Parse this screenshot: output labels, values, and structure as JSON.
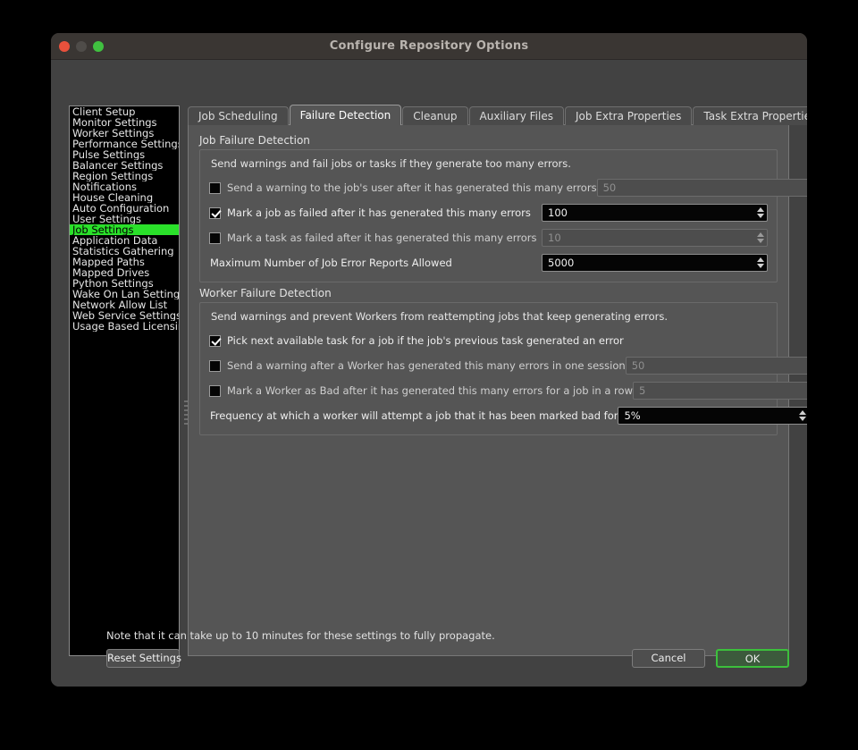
{
  "window": {
    "title": "Configure Repository Options",
    "traffic_lights": [
      "close-red",
      "minimize-gray",
      "zoom-green"
    ]
  },
  "sidebar": {
    "items": [
      {
        "label": "Client Setup",
        "selected": false
      },
      {
        "label": "Monitor Settings",
        "selected": false
      },
      {
        "label": "Worker Settings",
        "selected": false
      },
      {
        "label": "Performance Settings",
        "selected": false
      },
      {
        "label": "Pulse Settings",
        "selected": false
      },
      {
        "label": "Balancer Settings",
        "selected": false
      },
      {
        "label": "Region Settings",
        "selected": false
      },
      {
        "label": "Notifications",
        "selected": false
      },
      {
        "label": "House Cleaning",
        "selected": false
      },
      {
        "label": "Auto Configuration",
        "selected": false
      },
      {
        "label": "User Settings",
        "selected": false
      },
      {
        "label": "Job Settings",
        "selected": true
      },
      {
        "label": "Application Data",
        "selected": false
      },
      {
        "label": "Statistics Gathering",
        "selected": false
      },
      {
        "label": "Mapped Paths",
        "selected": false
      },
      {
        "label": "Mapped Drives",
        "selected": false
      },
      {
        "label": "Python Settings",
        "selected": false
      },
      {
        "label": "Wake On Lan Settings",
        "selected": false
      },
      {
        "label": "Network Allow List",
        "selected": false
      },
      {
        "label": "Web Service Settings",
        "selected": false
      },
      {
        "label": "Usage Based Licensing",
        "selected": false
      }
    ],
    "selected_color": "#2ae02a"
  },
  "tabs": [
    {
      "label": "Job Scheduling",
      "active": false
    },
    {
      "label": "Failure Detection",
      "active": true
    },
    {
      "label": "Cleanup",
      "active": false
    },
    {
      "label": "Auxiliary Files",
      "active": false
    },
    {
      "label": "Job Extra Properties",
      "active": false
    },
    {
      "label": "Task Extra Properties",
      "active": false
    }
  ],
  "job_failure": {
    "title": "Job Failure Detection",
    "description": "Send warnings and fail jobs or tasks if they generate too many errors.",
    "rows": [
      {
        "type": "checkbox",
        "label": "Send a warning to the job's user after it has generated this many errors",
        "checked": false,
        "value": "50",
        "enabled": false
      },
      {
        "type": "checkbox",
        "label": "Mark a job as failed after it has generated this many errors",
        "checked": true,
        "value": "100",
        "enabled": true
      },
      {
        "type": "checkbox",
        "label": "Mark a task as failed after it has generated this many errors",
        "checked": false,
        "value": "10",
        "enabled": false
      },
      {
        "type": "label",
        "label": "Maximum Number of Job Error Reports Allowed",
        "value": "5000",
        "enabled": true
      }
    ]
  },
  "worker_failure": {
    "title": "Worker Failure Detection",
    "description": "Send warnings and prevent Workers from reattempting jobs that keep generating errors.",
    "rows": [
      {
        "type": "checkbox-only",
        "label": "Pick next available task for a job if the job's previous task generated an error",
        "checked": true
      },
      {
        "type": "checkbox",
        "label": "Send a warning after a Worker has generated this many errors in one session",
        "checked": false,
        "value": "50",
        "enabled": false
      },
      {
        "type": "checkbox",
        "label": "Mark a Worker as Bad after it has generated this many errors for a job in a row",
        "checked": false,
        "value": "5",
        "enabled": false
      },
      {
        "type": "label",
        "label": "Frequency at which a worker will attempt a job that it has been marked bad for",
        "value": "5%",
        "enabled": true
      }
    ]
  },
  "footer": {
    "note": "Note that it can take up to 10 minutes for these settings to fully propagate.",
    "reset_label": "Reset Settings",
    "cancel_label": "Cancel",
    "ok_label": "OK",
    "ok_accent": "#3cc03c"
  }
}
